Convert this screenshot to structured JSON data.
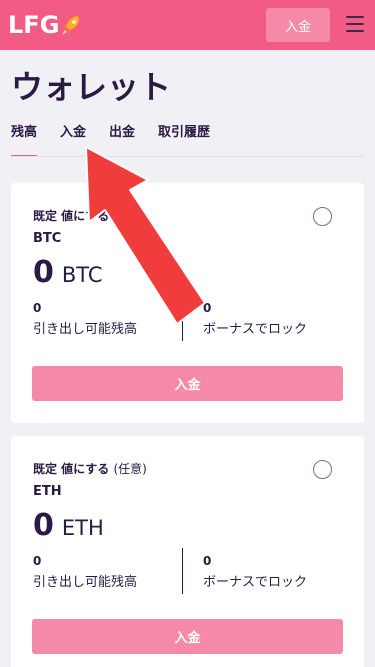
{
  "header": {
    "logo_text": "LFG",
    "deposit_label": "入金",
    "accent_color": "#f25c84"
  },
  "page": {
    "title": "ウォレット"
  },
  "tabs": [
    {
      "label": "残高",
      "active": true
    },
    {
      "label": "入金",
      "active": false
    },
    {
      "label": "出金",
      "active": false
    },
    {
      "label": "取引履歴",
      "active": false
    }
  ],
  "wallets": [
    {
      "default_label": "既定 値にする",
      "optional_label": "(任意)",
      "currency": "BTC",
      "balance": "0",
      "balance_currency": "BTC",
      "withdrawable_value": "0",
      "withdrawable_label": "引き出し可能残高",
      "bonus_value": "0",
      "bonus_label": "ボーナスでロック",
      "deposit_label": "入金"
    },
    {
      "default_label": "既定 値にする",
      "optional_label": "(任意)",
      "currency": "ETH",
      "balance": "0",
      "balance_currency": "ETH",
      "withdrawable_value": "0",
      "withdrawable_label": "引き出し可能残高",
      "bonus_value": "0",
      "bonus_label": "ボーナスでロック",
      "deposit_label": "入金"
    }
  ],
  "icons": {
    "logo": "rocket-icon",
    "menu": "hamburger-menu-icon",
    "overlay": "red-arrow-annotation"
  }
}
